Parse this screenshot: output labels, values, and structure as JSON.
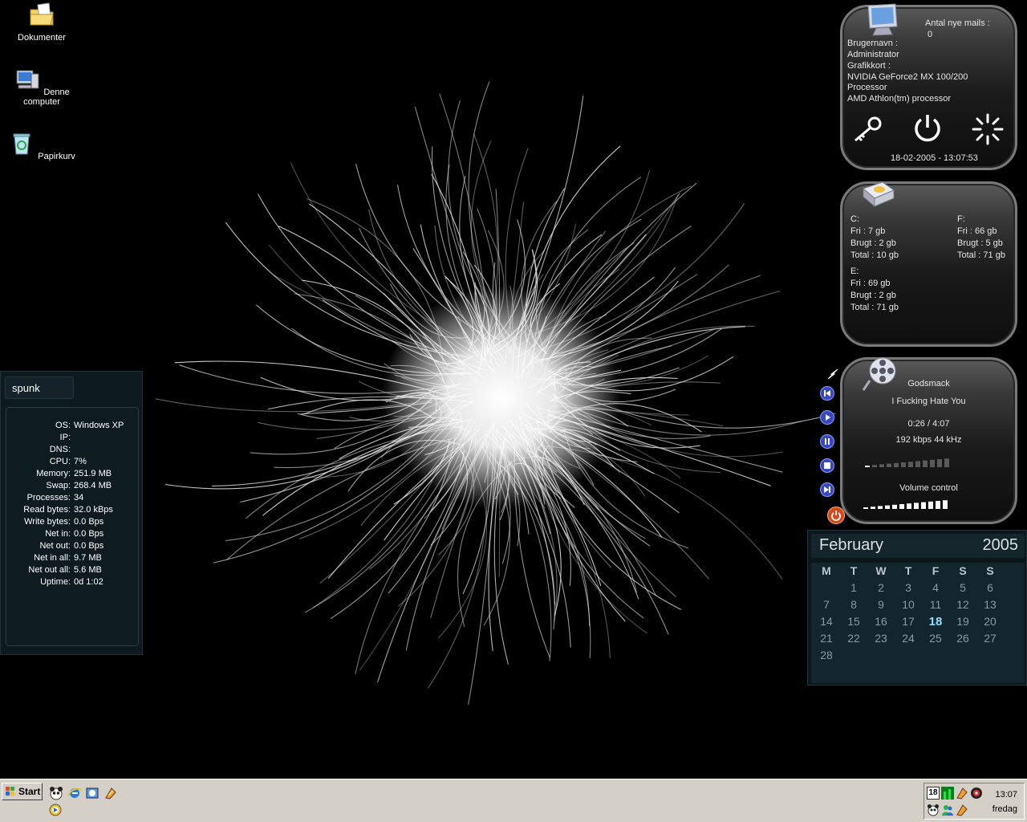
{
  "desktop_icons": [
    {
      "label": "Dokumenter"
    },
    {
      "label": "Denne computer"
    },
    {
      "label": "Papirkurv"
    }
  ],
  "sysinfo": {
    "hostname": "spunk",
    "rows": [
      {
        "key": "OS:",
        "value": "Windows XP"
      },
      {
        "key": "IP:",
        "value": ""
      },
      {
        "key": "DNS:",
        "value": ""
      },
      {
        "key": "CPU:",
        "value": "7%"
      },
      {
        "key": "Memory:",
        "value": "251.9 MB"
      },
      {
        "key": "Swap:",
        "value": "268.4 MB"
      },
      {
        "key": "Processes:",
        "value": "34"
      },
      {
        "key": "Read bytes:",
        "value": "32.0 kBps"
      },
      {
        "key": "Write bytes:",
        "value": "0.0 Bps"
      },
      {
        "key": "Net in:",
        "value": "0.0 Bps"
      },
      {
        "key": "Net out:",
        "value": "0.0 Bps"
      },
      {
        "key": "Net in all:",
        "value": "9.7 MB"
      },
      {
        "key": "Net out all:",
        "value": "5.6 MB"
      },
      {
        "key": "Uptime:",
        "value": "0d 1:02"
      }
    ]
  },
  "system_widget": {
    "mail_label": "Antal nye mails :",
    "mail_count": "0",
    "user_label": "Brugernavn :",
    "user_value": "Administrator",
    "gpu_label": "Grafikkort :",
    "gpu_value": "NVIDIA GeForce2 MX 100/200",
    "cpu_label": "Processor",
    "cpu_value": "AMD Athlon(tm) processor",
    "datetime": "18-02-2005 - 13:07:53",
    "icons": [
      "key-icon",
      "power-icon",
      "loading-icon"
    ]
  },
  "drives_widget": {
    "c": {
      "label": "C:",
      "free": "Fri : 7 gb",
      "used": "Brugt : 2 gb",
      "total": "Total : 10 gb"
    },
    "f": {
      "label": "F:",
      "free": "Fri : 66 gb",
      "used": "Brugt : 5 gb",
      "total": "Total : 71 gb"
    },
    "e": {
      "label": "E:",
      "free": "Fri : 69 gb",
      "used": "Brugt : 2 gb",
      "total": "Total : 71 gb"
    }
  },
  "media_widget": {
    "artist": "Godsmack",
    "track": "I Fucking Hate You",
    "time": "0:26 / 4:07",
    "bitrate": "192 kbps 44 kHz",
    "volume_label": "Volume control",
    "progress": 0.105,
    "volume": 1.0,
    "controls": [
      "previous-icon",
      "play-icon",
      "pause-icon",
      "stop-icon",
      "next-icon",
      "close-icon"
    ]
  },
  "calendar": {
    "month": "February",
    "year": "2005",
    "weekdays": [
      "M",
      "T",
      "W",
      "T",
      "F",
      "S",
      "S"
    ],
    "weeks": [
      [
        "",
        "1",
        "2",
        "3",
        "4",
        "5",
        "6"
      ],
      [
        "7",
        "8",
        "9",
        "10",
        "11",
        "12",
        "13"
      ],
      [
        "14",
        "15",
        "16",
        "17",
        "18",
        "19",
        "20"
      ],
      [
        "21",
        "22",
        "23",
        "24",
        "25",
        "26",
        "27"
      ],
      [
        "28",
        "",
        "",
        "",
        "",
        "",
        ""
      ]
    ],
    "today": "18"
  },
  "taskbar": {
    "start_label": "Start",
    "clock": "13:07",
    "day": "fredag",
    "tray_date": "18"
  },
  "colors": {
    "widget_border": "#7a7a7a",
    "media_button": "#3a48c0",
    "calendar_bg": "#0c171c",
    "taskbar": "#d4d0c8"
  }
}
